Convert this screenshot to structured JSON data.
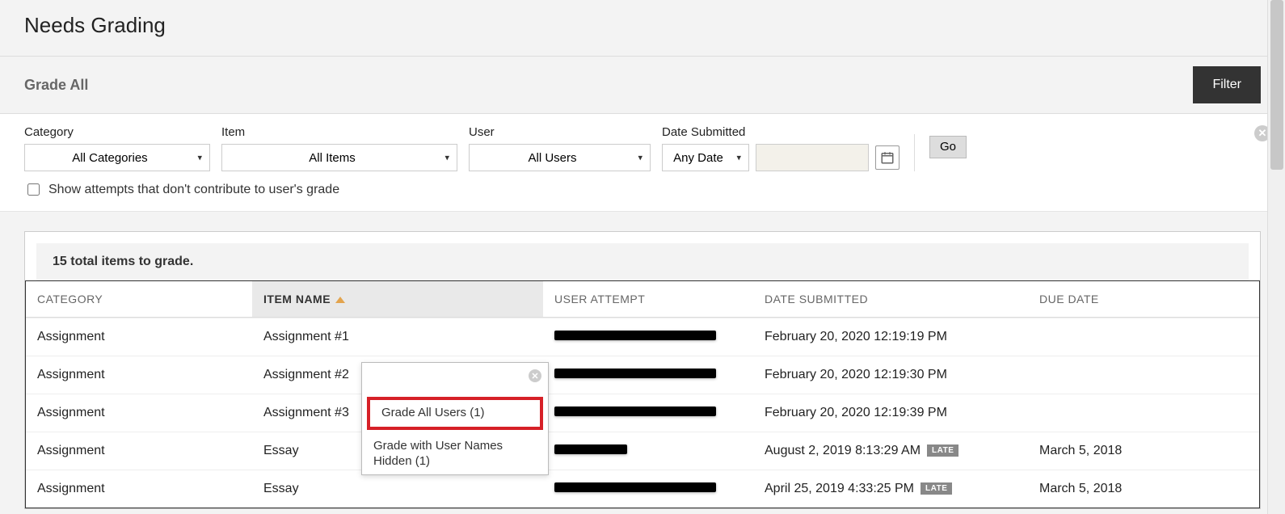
{
  "page_title": "Needs Grading",
  "grade_all_label": "Grade All",
  "filter_button_label": "Filter",
  "filters": {
    "category": {
      "label": "Category",
      "selected": "All Categories"
    },
    "item": {
      "label": "Item",
      "selected": "All Items"
    },
    "user": {
      "label": "User",
      "selected": "All Users"
    },
    "date_submitted": {
      "label": "Date Submitted",
      "selected": "Any Date"
    },
    "go_label": "Go",
    "show_attempts_checkbox": "Show attempts that don't contribute to user's grade"
  },
  "total_count_text": "15 total items to grade.",
  "columns": {
    "category": "CATEGORY",
    "item_name": "ITEM NAME",
    "user_attempt": "USER ATTEMPT",
    "date_submitted": "DATE SUBMITTED",
    "due_date": "DUE DATE"
  },
  "rows": [
    {
      "category": "Assignment",
      "item_name": "Assignment #1",
      "user_redacted_width": "redacted-200",
      "date_submitted": "February 20, 2020 12:19:19 PM",
      "late": false,
      "due_date": ""
    },
    {
      "category": "Assignment",
      "item_name": "Assignment #2",
      "user_redacted_width": "redacted-200",
      "date_submitted": "February 20, 2020 12:19:30 PM",
      "late": false,
      "due_date": ""
    },
    {
      "category": "Assignment",
      "item_name": "Assignment #3",
      "user_redacted_width": "redacted-200",
      "date_submitted": "February 20, 2020 12:19:39 PM",
      "late": false,
      "due_date": ""
    },
    {
      "category": "Assignment",
      "item_name": "Essay",
      "user_redacted_width": "redacted-90",
      "date_submitted": "August 2, 2019 8:13:29 AM",
      "late": true,
      "due_date": "March 5, 2018"
    },
    {
      "category": "Assignment",
      "item_name": "Essay",
      "user_redacted_width": "redacted-200",
      "date_submitted": "April 25, 2019 4:33:25 PM",
      "late": true,
      "due_date": "March 5, 2018"
    }
  ],
  "late_badge": "LATE",
  "context_menu": {
    "grade_all_users": "Grade All Users (1)",
    "grade_hidden": "Grade with User Names Hidden (1)"
  }
}
